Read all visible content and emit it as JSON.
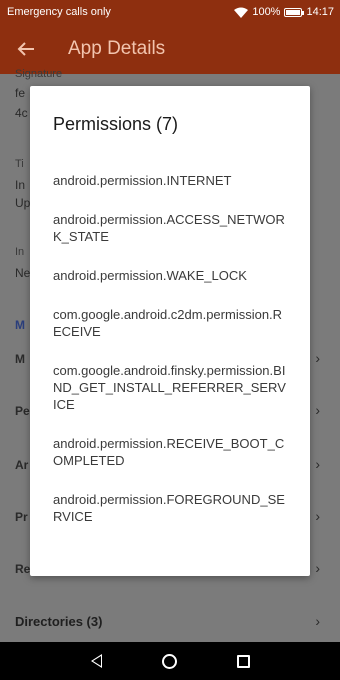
{
  "status_bar": {
    "carrier": "Emergency calls only",
    "battery": "100%",
    "time": "14:17"
  },
  "app_bar": {
    "title": "App Details"
  },
  "background": {
    "peeks": [
      "Signature",
      "fe",
      "4c",
      "Ti",
      "In",
      "Up",
      "In",
      "Ne",
      "M",
      "M",
      "Pe",
      "Ar",
      "Pr",
      "Re"
    ],
    "directories_label": "Directories (3)"
  },
  "dialog": {
    "title": "Permissions (7)",
    "permissions": [
      "android.permission.INTERNET",
      "android.permission.ACCESS_NETWORK_STATE",
      "android.permission.WAKE_LOCK",
      "com.google.android.c2dm.permission.RECEIVE",
      "com.google.android.finsky.permission.BIND_GET_INSTALL_REFERRER_SERVICE",
      "android.permission.RECEIVE_BOOT_COMPLETED",
      "android.permission.FOREGROUND_SERVICE"
    ]
  },
  "icons": {
    "back": "arrow-back-icon",
    "wifi": "wifi-icon",
    "battery": "battery-icon",
    "chevron": "chevron-right-icon"
  }
}
